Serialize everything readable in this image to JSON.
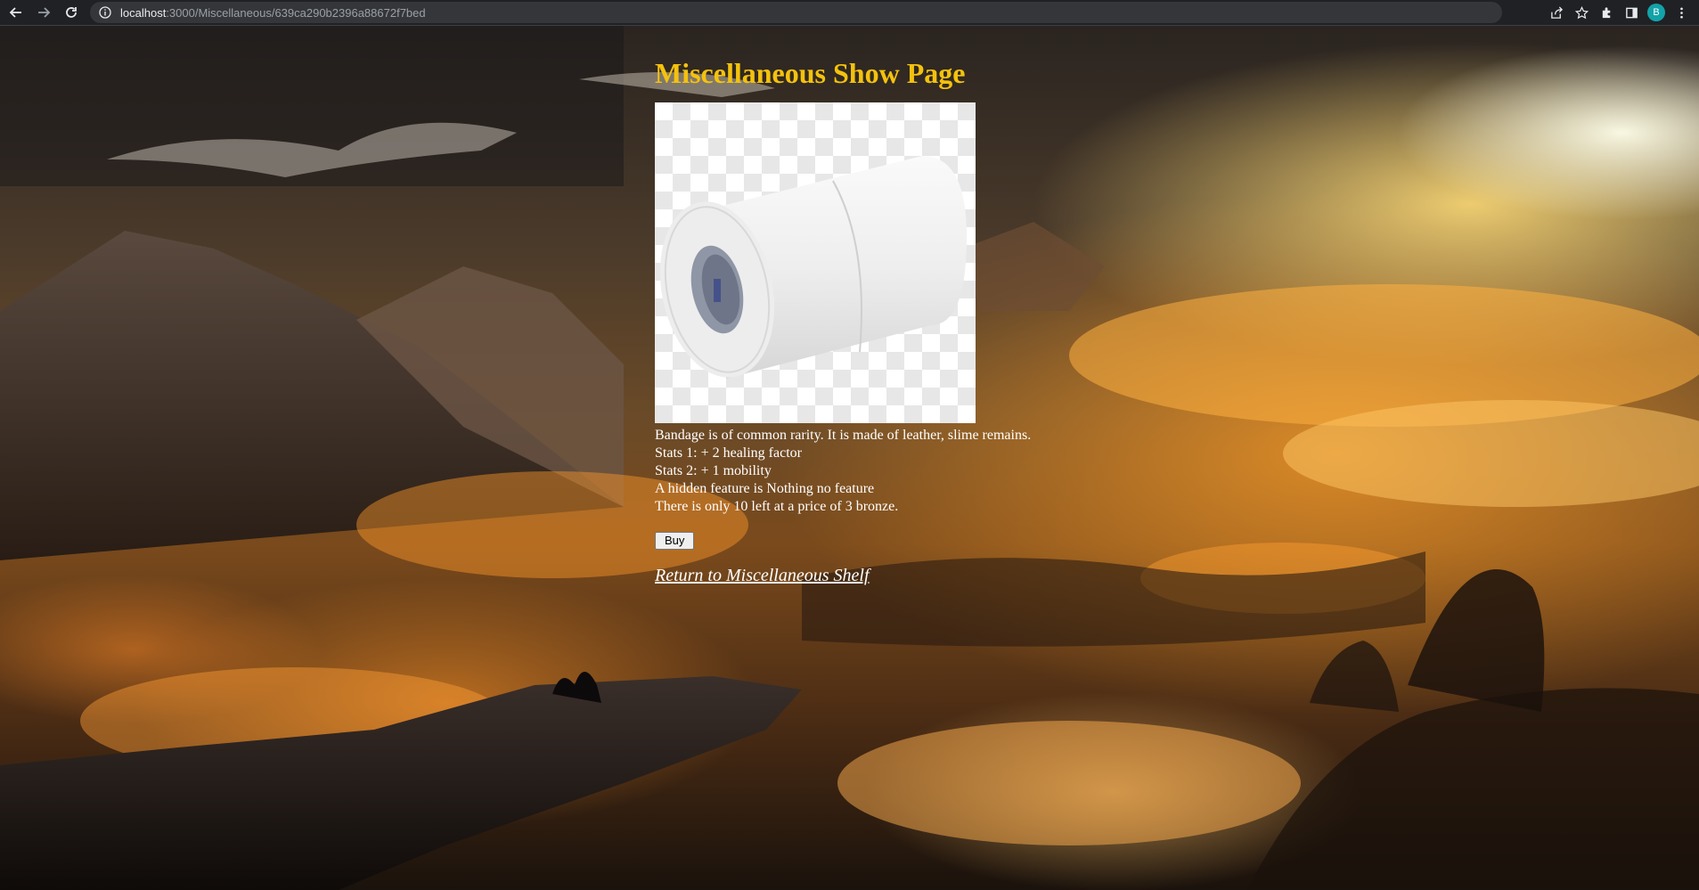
{
  "browser": {
    "url_host": "localhost",
    "url_rest": ":3000/Miscellaneous/639ca290b2396a88672f7bed",
    "profile_initial": "B"
  },
  "page": {
    "title": "Miscellaneous Show Page",
    "description_lines": [
      "Bandage is of common rarity. It is made of leather, slime remains.",
      "Stats 1: + 2 healing factor",
      "Stats 2: + 1 mobility",
      "A hidden feature is Nothing no feature",
      "There is only 10 left at a price of 3 bronze."
    ],
    "buy_label": "Buy",
    "return_label": "Return to Miscellaneous Shelf"
  },
  "colors": {
    "title": "#f4c20d",
    "text": "#ffffff",
    "chrome_bg": "#202124",
    "avatar": "#12a3a8"
  },
  "icons": [
    "back-icon",
    "forward-icon",
    "reload-icon",
    "info-icon",
    "share-icon",
    "star-icon",
    "extensions-icon",
    "sidepanel-icon",
    "menu-icon"
  ]
}
